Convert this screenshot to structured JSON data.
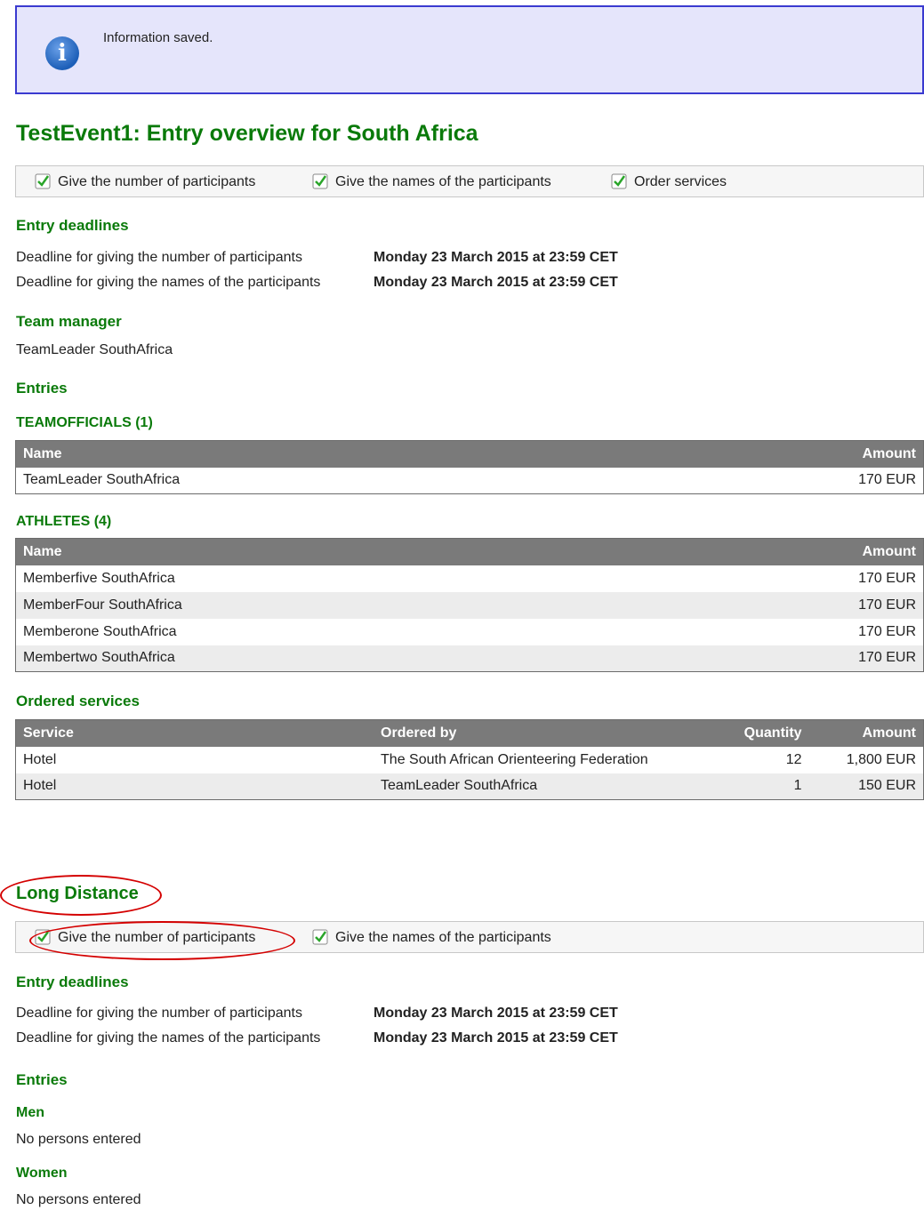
{
  "notice": {
    "text": "Information saved."
  },
  "event": {
    "title": "TestEvent1: Entry overview for South Africa",
    "steps": [
      "Give the number of participants",
      "Give the names of the participants",
      "Order services"
    ],
    "deadlines_heading": "Entry deadlines",
    "deadlines": [
      {
        "label": "Deadline for giving the number of participants",
        "value": "Monday 23 March 2015 at 23:59 CET"
      },
      {
        "label": "Deadline for giving the names of the participants",
        "value": "Monday 23 March 2015 at 23:59 CET"
      }
    ],
    "team_manager_heading": "Team manager",
    "team_manager": "TeamLeader SouthAfrica",
    "entries_heading": "Entries",
    "teamofficials": {
      "heading": "TEAMOFFICIALS (1)",
      "columns": [
        "Name",
        "Amount"
      ],
      "rows": [
        {
          "name": "TeamLeader SouthAfrica",
          "amount": "170 EUR"
        }
      ]
    },
    "athletes": {
      "heading": "ATHLETES (4)",
      "columns": [
        "Name",
        "Amount"
      ],
      "rows": [
        {
          "name": "Memberfive SouthAfrica",
          "amount": "170 EUR"
        },
        {
          "name": "MemberFour SouthAfrica",
          "amount": "170 EUR"
        },
        {
          "name": "Memberone SouthAfrica",
          "amount": "170 EUR"
        },
        {
          "name": "Membertwo SouthAfrica",
          "amount": "170 EUR"
        }
      ]
    },
    "services": {
      "heading": "Ordered services",
      "columns": [
        "Service",
        "Ordered by",
        "Quantity",
        "Amount"
      ],
      "rows": [
        {
          "service": "Hotel",
          "ordered_by": "The South African Orienteering Federation",
          "quantity": "12",
          "amount": "1,800 EUR"
        },
        {
          "service": "Hotel",
          "ordered_by": "TeamLeader SouthAfrica",
          "quantity": "1",
          "amount": "150 EUR"
        }
      ]
    }
  },
  "long_distance": {
    "title": "Long Distance",
    "steps": [
      "Give the number of participants",
      "Give the names of the participants"
    ],
    "deadlines_heading": "Entry deadlines",
    "deadlines": [
      {
        "label": "Deadline for giving the number of participants",
        "value": "Monday 23 March 2015 at 23:59 CET"
      },
      {
        "label": "Deadline for giving the names of the participants",
        "value": "Monday 23 March 2015 at 23:59 CET"
      }
    ],
    "entries_heading": "Entries",
    "men_heading": "Men",
    "men_text": "No persons entered",
    "women_heading": "Women",
    "women_text": "No persons entered"
  },
  "colors": {
    "heading_green": "#0a7a0a",
    "info_bg": "#e5e5fb",
    "info_border": "#3a3ad0",
    "table_header": "#7a7a7a",
    "annotation_red": "#d40000"
  },
  "icons": {
    "notice": "info-icon",
    "step": "check-icon"
  }
}
